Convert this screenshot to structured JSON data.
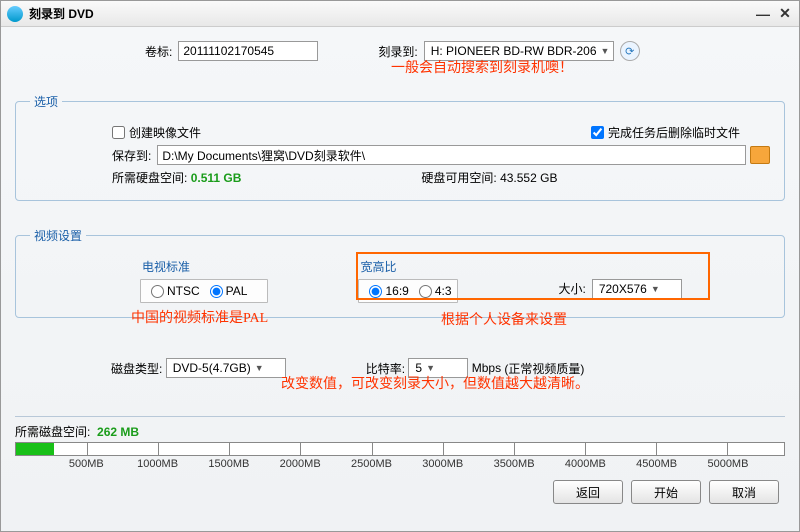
{
  "window": {
    "title": "刻录到 DVD"
  },
  "top": {
    "volume_label": "卷标:",
    "volume_value": "20111102170545",
    "burn_to_label": "刻录到:",
    "burn_to_value": "H: PIONEER  BD-RW  BDR-206"
  },
  "options": {
    "legend": "选项",
    "create_image_label": "创建映像文件",
    "create_image_checked": false,
    "delete_temp_label": "完成任务后删除临时文件",
    "delete_temp_checked": true,
    "save_to_label": "保存到:",
    "save_to_path": "D:\\My Documents\\狸窝\\DVD刻录软件\\",
    "req_space_label": "所需硬盘空间:",
    "req_space_value": "0.511 GB",
    "avail_space_label": "硬盘可用空间:",
    "avail_space_value": "43.552 GB"
  },
  "video": {
    "legend": "视频设置",
    "tv_standard_label": "电视标准",
    "ntsc": "NTSC",
    "pal": "PAL",
    "aspect_label": "宽高比",
    "ratio169": "16:9",
    "ratio43": "4:3",
    "size_label": "大小:",
    "size_value": "720X576",
    "disc_type_label": "磁盘类型:",
    "disc_type_value": "DVD-5(4.7GB)",
    "bitrate_label": "比特率:",
    "bitrate_value": "5",
    "bitrate_unit": "Mbps",
    "bitrate_note": "(正常视频质量)"
  },
  "annot": {
    "a1": "一般会自动搜索到刻录机噢！",
    "a2": "中国的视频标准是PAL",
    "a3": "根据个人设备来设置",
    "a4": "改变数值，可改变刻录大小，但数值越大越清晰。"
  },
  "space": {
    "label": "所需磁盘空间:",
    "value": "262 MB",
    "ticks": [
      "500MB",
      "1000MB",
      "1500MB",
      "2000MB",
      "2500MB",
      "3000MB",
      "3500MB",
      "4000MB",
      "4500MB",
      "5000MB"
    ]
  },
  "buttons": {
    "back": "返回",
    "start": "开始",
    "cancel": "取消"
  }
}
